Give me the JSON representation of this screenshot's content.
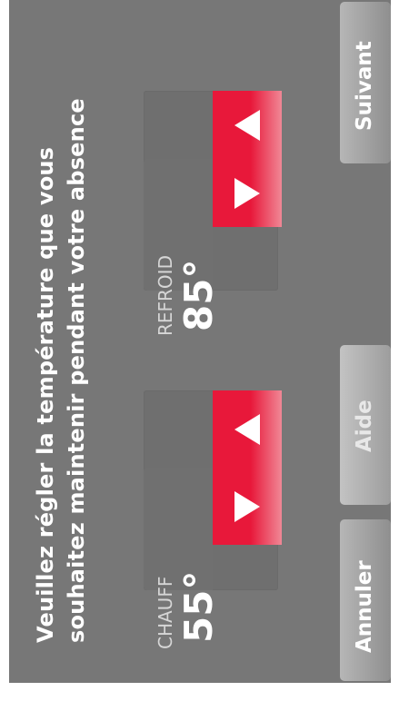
{
  "prompt": {
    "line1": "Veuillez régler la température que vous",
    "line2": "souhaitez maintenir pendant votre absence"
  },
  "heat": {
    "label": "CHAUFF",
    "value": "55°"
  },
  "cool": {
    "label": "REFROID",
    "value": "85°"
  },
  "buttons": {
    "cancel": "Annuler",
    "help": "Aide",
    "next": "Suivant"
  },
  "colors": {
    "accent": "#e8183a",
    "background": "#777777",
    "text": "#ffffff"
  },
  "icons": {
    "increase": "left-triangle-icon",
    "decrease": "right-triangle-icon"
  }
}
